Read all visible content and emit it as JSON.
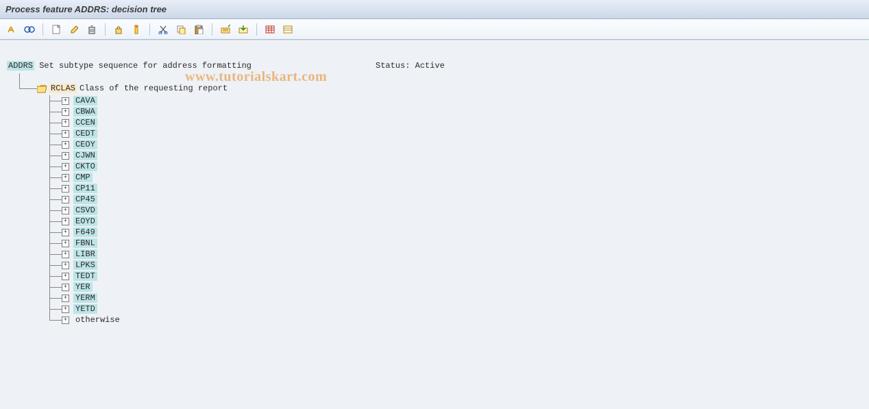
{
  "titlebar": {
    "text": "Process feature ADDRS: decision tree"
  },
  "toolbar": {
    "buttons": [
      "check",
      "glasses",
      "sep",
      "new",
      "edit",
      "delete",
      "sep",
      "lock",
      "key",
      "sep",
      "cut",
      "copy",
      "paste",
      "sep",
      "where",
      "insert",
      "sep",
      "table1",
      "table2"
    ]
  },
  "root": {
    "code": "ADDRS",
    "desc": "Set subtype sequence for address formatting",
    "status_label": "Status:",
    "status_value": "Active"
  },
  "branch": {
    "code": "RCLAS",
    "desc": "Class of the requesting report"
  },
  "children": [
    {
      "code": "CAVA",
      "hl": true
    },
    {
      "code": "CBWA",
      "hl": true
    },
    {
      "code": "CCEN",
      "hl": true
    },
    {
      "code": "CEDT",
      "hl": true
    },
    {
      "code": "CEOY",
      "hl": true
    },
    {
      "code": "CJWN",
      "hl": true
    },
    {
      "code": "CKTO",
      "hl": true
    },
    {
      "code": "CMP",
      "hl": true
    },
    {
      "code": "CP11",
      "hl": true
    },
    {
      "code": "CP45",
      "hl": true
    },
    {
      "code": "CSVD",
      "hl": true
    },
    {
      "code": "EOYD",
      "hl": true
    },
    {
      "code": "F649",
      "hl": true
    },
    {
      "code": "FBNL",
      "hl": true
    },
    {
      "code": "LIBR",
      "hl": true
    },
    {
      "code": "LPKS",
      "hl": true
    },
    {
      "code": "TEDT",
      "hl": true
    },
    {
      "code": "YER",
      "hl": true
    },
    {
      "code": "YERM",
      "hl": true
    },
    {
      "code": "YETD",
      "hl": true
    },
    {
      "code": "otherwise",
      "hl": false
    }
  ],
  "watermark": "www.tutorialskart.com"
}
